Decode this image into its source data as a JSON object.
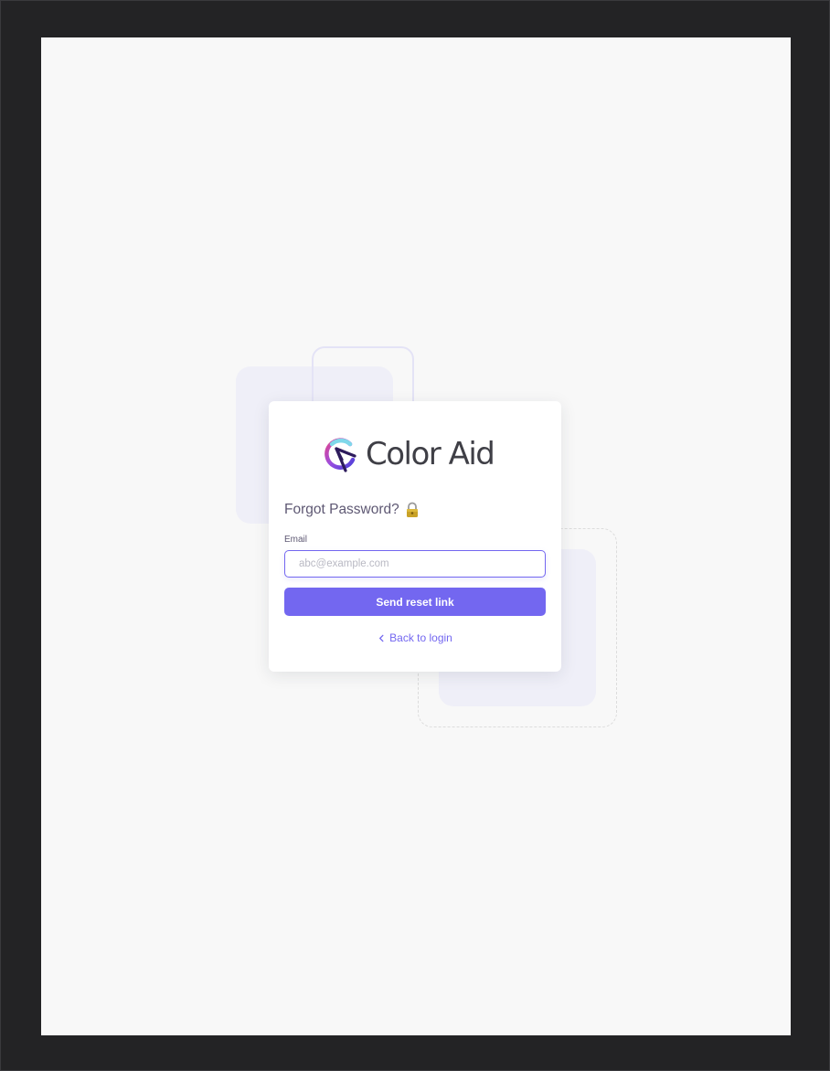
{
  "logo": {
    "text": "Color Aid",
    "icon": "color-aid-logo-icon"
  },
  "form": {
    "title": "Forgot Password?",
    "title_icon": "lock-icon",
    "email_label": "Email",
    "email_value": "",
    "email_placeholder": "abc@example.com",
    "submit_label": "Send reset link",
    "back_label": "Back to login",
    "back_icon": "chevron-left-icon"
  },
  "colors": {
    "primary": "#7367f0",
    "heading": "#5e5873",
    "page_background": "#f8f8f8",
    "window_frame": "#232325"
  }
}
